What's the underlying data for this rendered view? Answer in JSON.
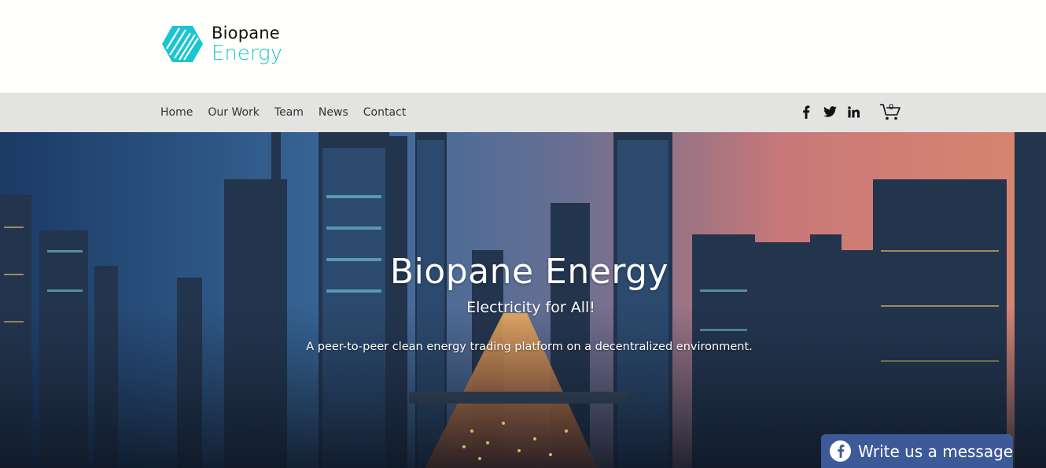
{
  "brand": {
    "name_line1": "Biopane",
    "name_line2": "Energy",
    "accent_color": "#19c6cf"
  },
  "nav": {
    "items": [
      {
        "label": "Home"
      },
      {
        "label": "Our Work"
      },
      {
        "label": "Team"
      },
      {
        "label": "News"
      },
      {
        "label": "Contact"
      }
    ]
  },
  "social": {
    "icons": [
      "facebook-icon",
      "twitter-icon",
      "linkedin-icon"
    ]
  },
  "cart": {
    "count": "0",
    "icon": "cart-icon"
  },
  "hero": {
    "title": "Biopane Energy",
    "subtitle": "Electricity for All!",
    "description": "A peer-to-peer clean energy trading platform on a decentralized environment."
  },
  "chat_widget": {
    "label": "Write us a message",
    "icon": "facebook-icon",
    "color": "#3d5a98"
  }
}
